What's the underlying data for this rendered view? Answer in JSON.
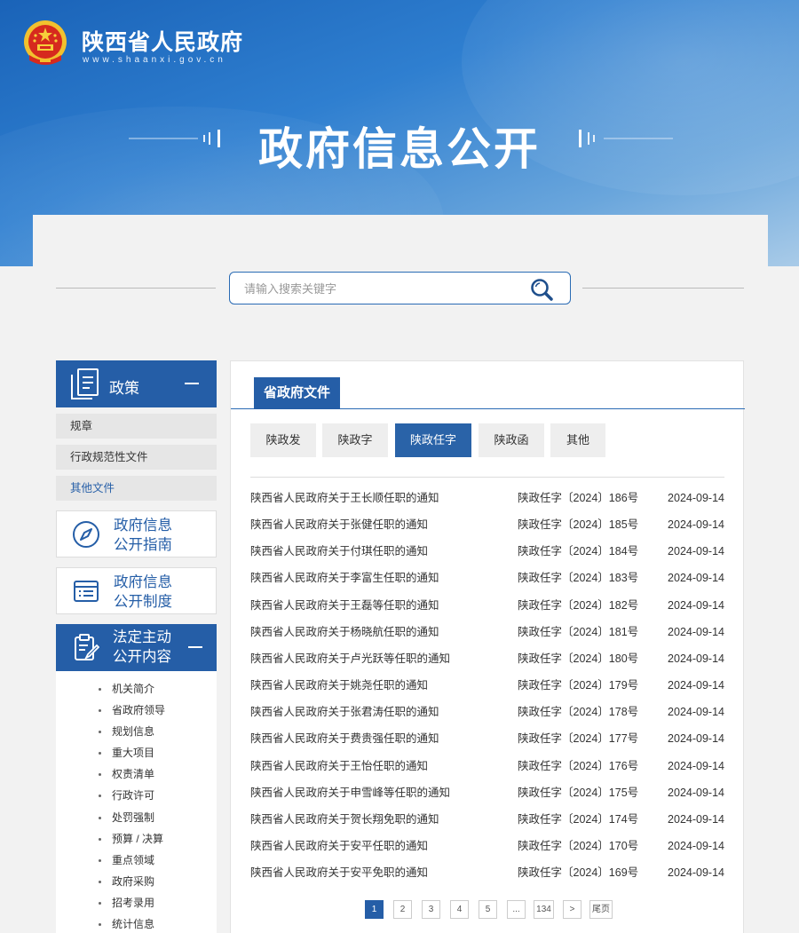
{
  "header": {
    "site_title": "陕西省人民政府",
    "site_url": "www.shaanxi.gov.cn",
    "hero_title": "政府信息公开"
  },
  "search": {
    "placeholder": "请输入搜索关键字"
  },
  "sidebar": {
    "policy_head": "政策",
    "policy_items": [
      "规章",
      "行政规范性文件",
      "其他文件"
    ],
    "guide_card": [
      "政府信息",
      "公开指南"
    ],
    "system_card": [
      "政府信息",
      "公开制度"
    ],
    "statutory_head": [
      "法定主动",
      "公开内容"
    ],
    "statutory_items": [
      "机关简介",
      "省政府领导",
      "规划信息",
      "重大项目",
      "权责清单",
      "行政许可",
      "处罚强制",
      "预算 / 决算",
      "重点领域",
      "政府采购",
      "招考录用",
      "统计信息"
    ]
  },
  "content": {
    "tab": "省政府文件",
    "sub_tabs": [
      "陕政发",
      "陕政字",
      "陕政任字",
      "陕政函",
      "其他"
    ],
    "active_sub_tab": "陕政任字",
    "rows": [
      {
        "title": "陕西省人民政府关于王长顺任职的通知",
        "num": "陕政任字〔2024〕186号",
        "date": "2024-09-14"
      },
      {
        "title": "陕西省人民政府关于张健任职的通知",
        "num": "陕政任字〔2024〕185号",
        "date": "2024-09-14"
      },
      {
        "title": "陕西省人民政府关于付琪任职的通知",
        "num": "陕政任字〔2024〕184号",
        "date": "2024-09-14"
      },
      {
        "title": "陕西省人民政府关于李富生任职的通知",
        "num": "陕政任字〔2024〕183号",
        "date": "2024-09-14"
      },
      {
        "title": "陕西省人民政府关于王磊等任职的通知",
        "num": "陕政任字〔2024〕182号",
        "date": "2024-09-14"
      },
      {
        "title": "陕西省人民政府关于杨晓航任职的通知",
        "num": "陕政任字〔2024〕181号",
        "date": "2024-09-14"
      },
      {
        "title": "陕西省人民政府关于卢光跃等任职的通知",
        "num": "陕政任字〔2024〕180号",
        "date": "2024-09-14"
      },
      {
        "title": "陕西省人民政府关于姚尧任职的通知",
        "num": "陕政任字〔2024〕179号",
        "date": "2024-09-14"
      },
      {
        "title": "陕西省人民政府关于张君涛任职的通知",
        "num": "陕政任字〔2024〕178号",
        "date": "2024-09-14"
      },
      {
        "title": "陕西省人民政府关于费贵强任职的通知",
        "num": "陕政任字〔2024〕177号",
        "date": "2024-09-14"
      },
      {
        "title": "陕西省人民政府关于王怡任职的通知",
        "num": "陕政任字〔2024〕176号",
        "date": "2024-09-14"
      },
      {
        "title": "陕西省人民政府关于申雪峰等任职的通知",
        "num": "陕政任字〔2024〕175号",
        "date": "2024-09-14"
      },
      {
        "title": "陕西省人民政府关于贺长翔免职的通知",
        "num": "陕政任字〔2024〕174号",
        "date": "2024-09-14"
      },
      {
        "title": "陕西省人民政府关于安平任职的通知",
        "num": "陕政任字〔2024〕170号",
        "date": "2024-09-14"
      },
      {
        "title": "陕西省人民政府关于安平免职的通知",
        "num": "陕政任字〔2024〕169号",
        "date": "2024-09-14"
      }
    ]
  },
  "pagination": {
    "pages": [
      "1",
      "2",
      "3",
      "4",
      "5",
      "...",
      "134",
      ">",
      "尾页"
    ],
    "current": "1"
  },
  "colors": {
    "primary": "#255ea7",
    "banner": "#2f7fd0"
  }
}
